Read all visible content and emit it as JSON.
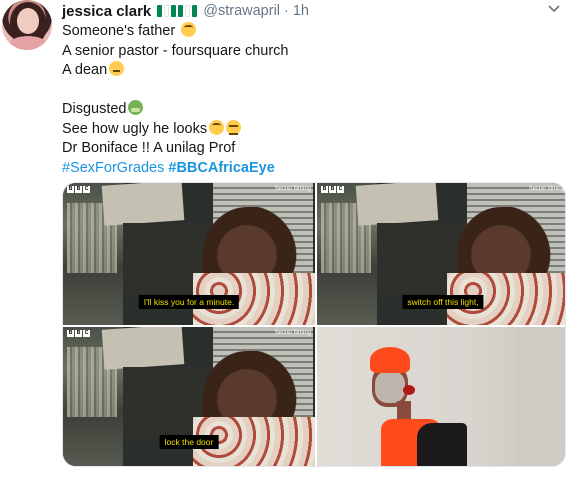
{
  "tweet": {
    "name": "jessica clark",
    "handle": "@strawapril",
    "separator": "·",
    "time": "1h",
    "menu_icon": "chevron-down-icon",
    "lines": {
      "l1": "Someone's father",
      "l2": "A senior pastor - foursquare church",
      "l3": "A dean",
      "l4": "Disgusted",
      "l5": "See how ugly he looks",
      "l6": "Dr Boniface !! A unilag Prof",
      "hashtag1": "#SexForGrades",
      "hashtag2": "#BBCAfricaEye"
    }
  },
  "media": {
    "frames": [
      {
        "bbc": [
          "B",
          "B",
          "C"
        ],
        "secret": "Secret filming",
        "subtitle": "I'll kiss you for a minute."
      },
      {
        "bbc": [
          "B",
          "B",
          "C"
        ],
        "secret": "Secret filming",
        "subtitle": "switch off this light,"
      },
      {
        "bbc": [
          "B",
          "B",
          "C"
        ],
        "secret": "Secret filming",
        "subtitle": "lock the door"
      },
      {
        "description_icon": "photo"
      }
    ]
  },
  "colors": {
    "link": "#1b95e0",
    "secondary": "#657786",
    "text": "#14171a"
  }
}
